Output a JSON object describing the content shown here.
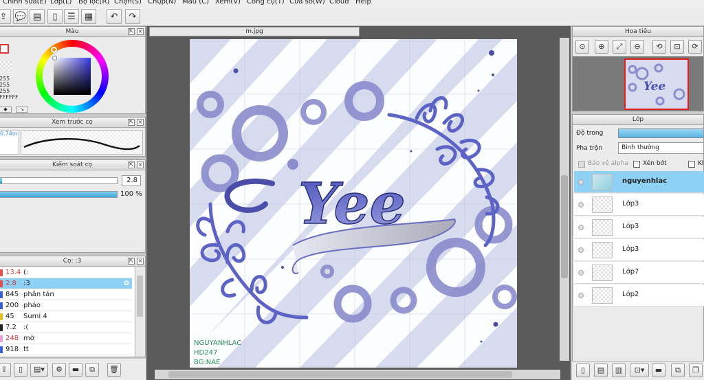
{
  "menu": [
    "Chỉnh sửa(E)",
    "Lớp(L)",
    "Bộ lọc(R)",
    "Chọn(S)",
    "Chụp(N)",
    "Màu (C)",
    "Xem(V)",
    "Công cụ(T)",
    "Cửa sổ(W)",
    "Cloud",
    "Help"
  ],
  "color_panel": {
    "title": "Màu",
    "readouts": [
      "255",
      "255",
      "255",
      "FFFFFF"
    ],
    "fg_color": "#ffffff",
    "accent": "#e03030"
  },
  "brush_preview": {
    "title": "Xem trước cọ",
    "size_label": "0.74m"
  },
  "brush_control": {
    "title": "Kiểm soát cọ",
    "size_value": "2.8",
    "density_value": "100 %",
    "density_fraction": 1.0
  },
  "brush_list": {
    "title": "Cọ: :3",
    "items": [
      {
        "size": "13.4",
        "name": "(:",
        "color": "#e05050",
        "size_red": true
      },
      {
        "size": "2.8",
        "name": ":3",
        "color": "#e05050",
        "size_red": true,
        "selected": true
      },
      {
        "size": "845",
        "name": "phân tán",
        "color": "#3a5fd0"
      },
      {
        "size": "200",
        "name": "pháo",
        "color": "#3a5fd0"
      },
      {
        "size": "45",
        "name": "Sumi 4",
        "color": "#e0c020"
      },
      {
        "size": "7.2",
        "name": ":(",
        "color": "#222222"
      },
      {
        "size": "248",
        "name": "mờ",
        "color": "#e8a0d8",
        "size_red": true
      },
      {
        "size": "918",
        "name": "tt",
        "color": "#3a5fd0"
      }
    ]
  },
  "document": {
    "tab_label": "m.jpg",
    "lettering": "Yee",
    "watermark": [
      "NGUYANHLAC",
      "HD247",
      "BG:NAE"
    ]
  },
  "navigator": {
    "title": "Hoa tiêu"
  },
  "layers": {
    "title": "Lớp",
    "opacity_label": "Độ trong",
    "blend_label": "Pha trộn",
    "blend_value": "Bình thường",
    "protect_alpha": "Bảo vệ alpha",
    "clip": "Xén bớt",
    "lock": "Kh",
    "items": [
      {
        "name": "nguyenhlac",
        "selected": true
      },
      {
        "name": "Lớp3"
      },
      {
        "name": "Lớp3"
      },
      {
        "name": "Lớp3"
      },
      {
        "name": "Lớp7"
      },
      {
        "name": "Lớp2"
      }
    ]
  }
}
